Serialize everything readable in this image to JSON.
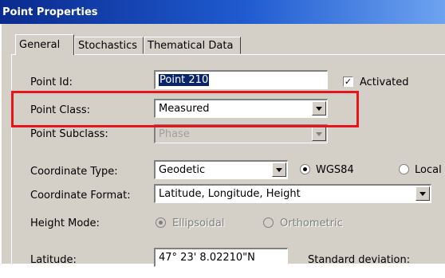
{
  "window": {
    "title": "Point Properties"
  },
  "tabs": [
    {
      "label": "General"
    },
    {
      "label": "Stochastics"
    },
    {
      "label": "Thematical Data"
    }
  ],
  "general": {
    "point_id": {
      "label": "Point Id:",
      "value": "Point 210"
    },
    "activated": {
      "label": "Activated",
      "checked": true
    },
    "point_class": {
      "label": "Point Class:",
      "value": "Measured"
    },
    "point_subclass": {
      "label": "Point Subclass:",
      "value": "Phase"
    },
    "coordinate_type": {
      "label": "Coordinate Type:",
      "value": "Geodetic"
    },
    "datum_options": {
      "wgs84": "WGS84",
      "local": "Local",
      "selected": "WGS84"
    },
    "coordinate_format": {
      "label": "Coordinate Format:",
      "value": "Latitude, Longitude, Height"
    },
    "height_mode": {
      "label": "Height Mode:",
      "ellipsoidal": "Ellipsoidal",
      "orthometric": "Orthometric",
      "selected": "Ellipsoidal"
    },
    "latitude": {
      "label": "Latitude:",
      "value": "47° 23'  8.02210\"N"
    },
    "std_dev_label": "Standard deviation:"
  },
  "colors": {
    "title_bar": "#0a2a8e",
    "highlight": "#e8141c",
    "dialog_bg": "#d4d0c8"
  }
}
